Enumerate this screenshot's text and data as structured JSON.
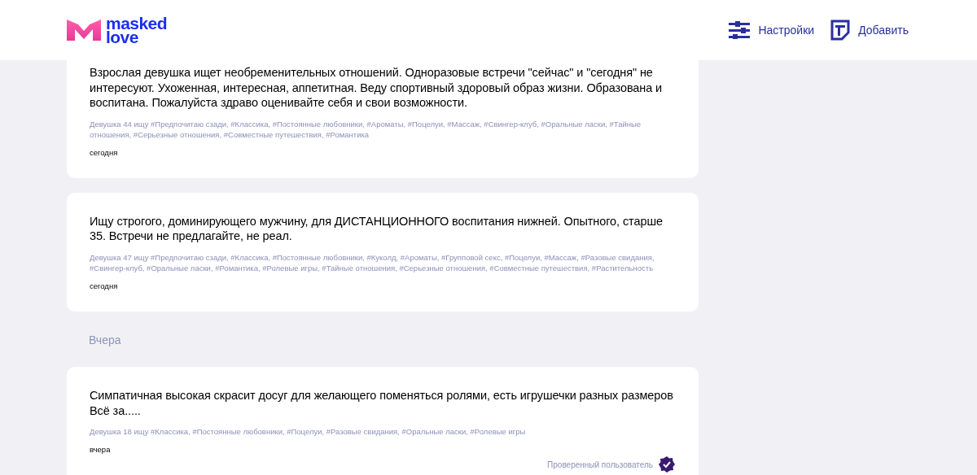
{
  "header": {
    "logo": {
      "line_1": "masked",
      "line_2": "love"
    },
    "nav": [
      {
        "kind": "settings",
        "label": "Настройки"
      },
      {
        "kind": "add",
        "label": "Добавить"
      }
    ]
  },
  "feed": [
    {
      "kind": "ad",
      "cut_top": true,
      "text": "Взрослая девушка ищет необременительных отношений. Одноразовые встречи \"сейчас\" и \"сегодня\" не интересуют. Ухоженная, интересная, аппетитная. Веду спортивный здоровый образ жизни. Образована и воспитана. Пожалуйста здраво оценивайте себя и свои возможности.",
      "tags": "Девушка 44 ищу #Предпочитаю сзади, #Классика, #Постоянные любовники, #Ароматы, #Поцелуи, #Массаж, #Свингер-клуб, #Оральные ласки, #Тайные отношения, #Серьезные отношения, #Совместные путешествия, #Романтика",
      "date": "сегодня",
      "verified": false
    },
    {
      "kind": "ad",
      "cut_top": false,
      "text": "Ищу строгого, доминирующего мужчину, для ДИСТАНЦИОННОГО воспитания нижней. Опытного, старше 35. Встречи не предлагайте, не реал.",
      "tags": "Девушка 47 ищу #Предпочитаю сзади, #Классика, #Постоянные любовники, #Куколд, #Ароматы, #Групповой секс, #Поцелуи, #Массаж, #Разовые свидания, #Свингер-клуб, #Оральные ласки, #Романтика, #Ролевые игры, #Тайные отношения, #Серьезные отношения, #Совместные путешествия, #Растительность",
      "date": "сегодня",
      "verified": false
    },
    {
      "kind": "day",
      "label": "Вчера"
    },
    {
      "kind": "ad",
      "cut_top": false,
      "text": "Симпатичная высокая скрасит досуг для желающего поменяться ролями, есть игрушечки разных размеров Всё за.....",
      "tags": "Девушка 18 ищу #Классика, #Постоянные любовники, #Поцелуи, #Разовые свидания, #Оральные ласки, #Ролевые игры",
      "date": "вчера",
      "verified": true,
      "verified_label": "Проверенный пользователь"
    }
  ]
}
